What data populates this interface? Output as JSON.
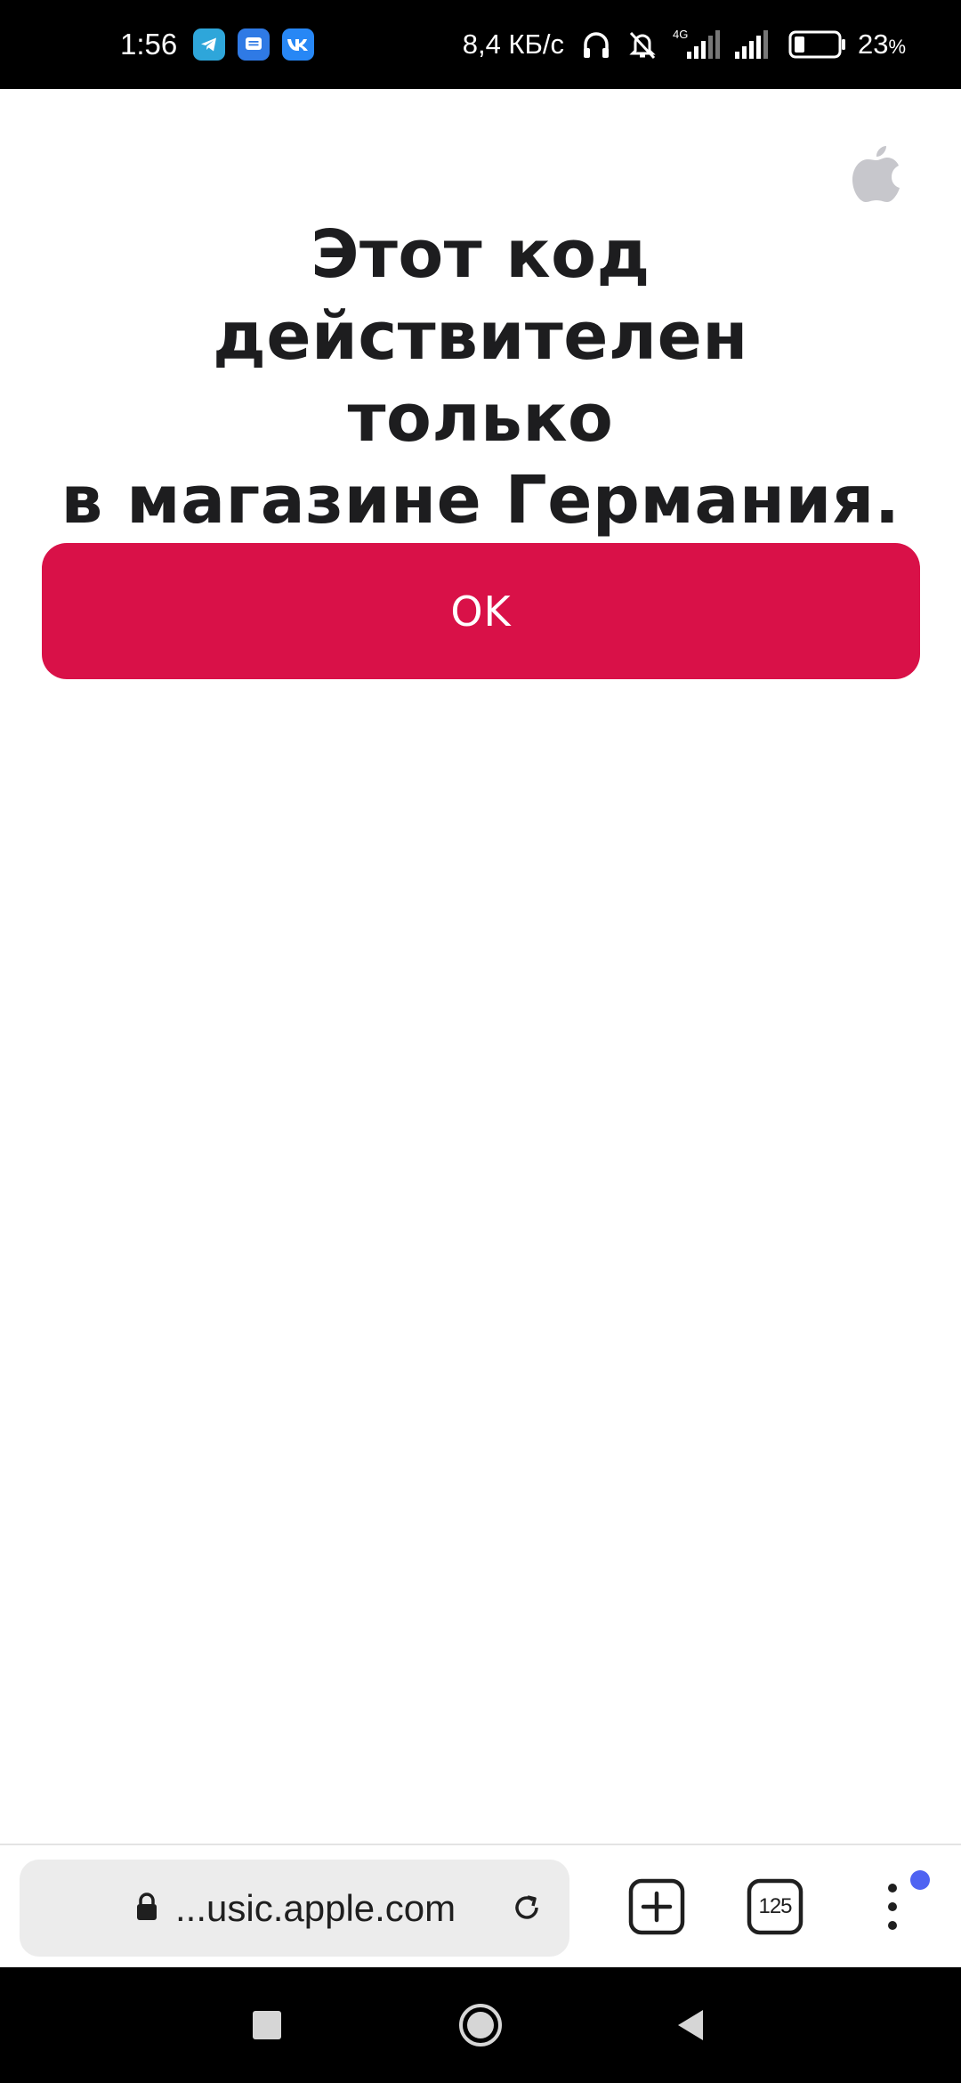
{
  "status_bar": {
    "time": "1:56",
    "network_speed": "8,4 КБ/с",
    "network_type": "4G",
    "battery_percent": "23",
    "battery_unit": "%",
    "battery_level": 0.23,
    "notification_icons": [
      "telegram-icon",
      "messages-icon",
      "vk-icon"
    ],
    "colors": {
      "telegram": "#2ea6da",
      "messages": "#2f7ae5",
      "vk": "#2787f5"
    }
  },
  "page": {
    "headline_lines": [
      "Этот код действителен",
      "только",
      "в магазине Германия."
    ],
    "ok_label": "OK",
    "accent_color": "#d91148"
  },
  "browser": {
    "url": "...usic.apple.com",
    "tabs_count": "125",
    "notify_dot_color": "#4f63f2"
  }
}
